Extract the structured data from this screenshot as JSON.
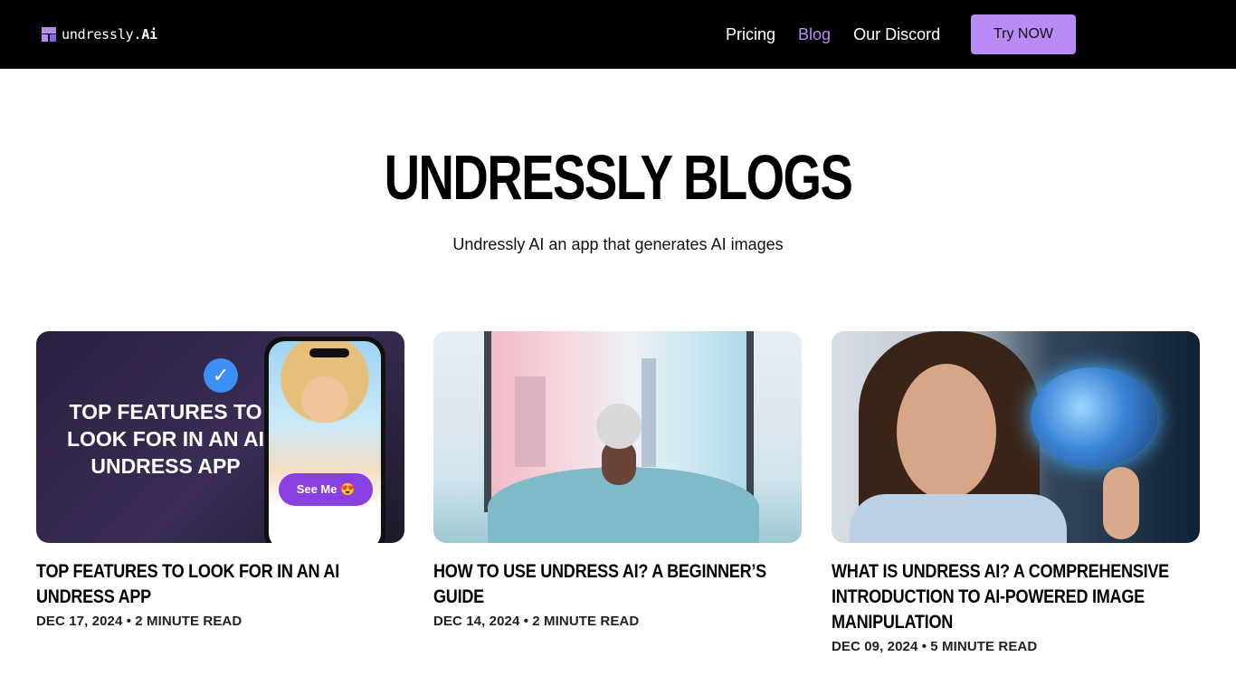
{
  "nav": {
    "logo_prefix": "undressly.",
    "logo_suffix": "Ai",
    "links": [
      "Pricing",
      "Blog",
      "Our Discord"
    ],
    "active_link": "Blog",
    "cta": "Try NOW"
  },
  "hero": {
    "title": "UNDRESSLY BLOGS",
    "subtitle": "Undressly AI an app that generates AI images"
  },
  "cards": [
    {
      "title": "TOP FEATURES TO LOOK FOR IN AN AI UNDRESS APP",
      "meta": "DEC 17, 2024 • 2 MINUTE READ",
      "image_text": "TOP FEATURES TO LOOK FOR IN AN AI UNDRESS APP",
      "image_button": "See Me 😍"
    },
    {
      "title": "HOW TO USE UNDRESS AI? A BEGINNER’S GUIDE",
      "meta": "DEC 14, 2024 • 2 MINUTE READ"
    },
    {
      "title": "WHAT IS UNDRESS AI? A COMPREHENSIVE INTRODUCTION TO AI-POWERED IMAGE MANIPULATION",
      "meta": "DEC 09, 2024 • 5 MINUTE READ"
    }
  ],
  "colors": {
    "nav_bg": "#000000",
    "accent": "#b88cf4"
  }
}
